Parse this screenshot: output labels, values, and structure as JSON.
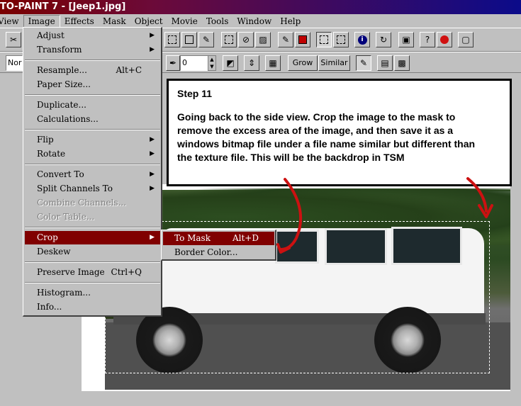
{
  "window": {
    "title": "TO-PAINT 7 - [Jeep1.jpg]"
  },
  "menubar": [
    {
      "label": "View"
    },
    {
      "label": "Image",
      "active": true
    },
    {
      "label": "Effects"
    },
    {
      "label": "Mask"
    },
    {
      "label": "Object"
    },
    {
      "label": "Movie"
    },
    {
      "label": "Tools"
    },
    {
      "label": "Window"
    },
    {
      "label": "Help"
    }
  ],
  "toolbar2": {
    "mode_value": "Nor",
    "opacity_value": "0",
    "grow_label": "Grow",
    "similar_label": "Similar"
  },
  "image_menu": {
    "adjust": "Adjust",
    "transform": "Transform",
    "resample": "Resample...",
    "resample_shortcut": "Alt+C",
    "paper_size": "Paper Size...",
    "duplicate": "Duplicate...",
    "calculations": "Calculations...",
    "flip": "Flip",
    "rotate": "Rotate",
    "convert_to": "Convert To",
    "split_channels": "Split Channels To",
    "combine_channels": "Combine Channels...",
    "color_table": "Color Table...",
    "crop": "Crop",
    "deskew": "Deskew",
    "preserve_image": "Preserve Image",
    "preserve_shortcut": "Ctrl+Q",
    "histogram": "Histogram...",
    "info": "Info..."
  },
  "crop_submenu": {
    "to_mask": "To Mask",
    "to_mask_shortcut": "Alt+D",
    "border_color": "Border Color..."
  },
  "step": {
    "title": "Step 11",
    "text": "Going back to the side view. Crop the image to the mask to\nremove the excess area of the image, and then save it    as a\nwindows bitmap file under a file name similar but different than\nthe texture file.  This will be the backdrop in TSM"
  },
  "colors": {
    "menu_highlight": "#800000",
    "arrow": "#cc1111"
  }
}
